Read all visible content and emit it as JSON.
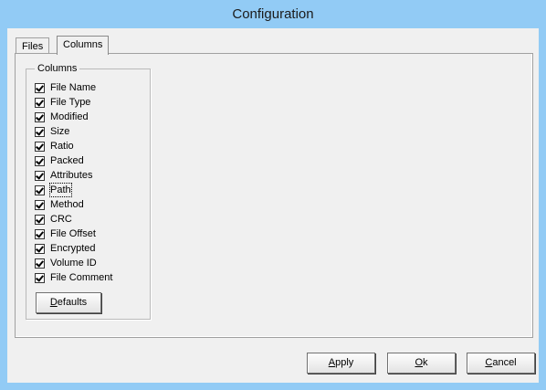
{
  "window": {
    "title": "Configuration"
  },
  "tabs": [
    {
      "label": "Files",
      "active": false
    },
    {
      "label": "Columns",
      "active": true
    }
  ],
  "columns_group": {
    "legend": "Columns",
    "items": [
      {
        "label": "File Name",
        "checked": true
      },
      {
        "label": "File Type",
        "checked": true
      },
      {
        "label": "Modified",
        "checked": true
      },
      {
        "label": "Size",
        "checked": true
      },
      {
        "label": "Ratio",
        "checked": true
      },
      {
        "label": "Packed",
        "checked": true
      },
      {
        "label": "Attributes",
        "checked": true
      },
      {
        "label": "Path",
        "checked": true
      },
      {
        "label": "Method",
        "checked": true
      },
      {
        "label": "CRC",
        "checked": true
      },
      {
        "label": "File Offset",
        "checked": true
      },
      {
        "label": "Encrypted",
        "checked": true
      },
      {
        "label": "Volume ID",
        "checked": true
      },
      {
        "label": "File Comment",
        "checked": true
      }
    ],
    "defaults_button": {
      "mnemonic": "D",
      "rest": "efaults"
    }
  },
  "buttons": {
    "apply": {
      "mnemonic": "A",
      "rest": "pply"
    },
    "ok": {
      "mnemonic": "O",
      "rest": "k"
    },
    "cancel": {
      "mnemonic": "C",
      "rest": "ancel"
    }
  },
  "colors": {
    "titlebar": "#92cbf5",
    "client": "#f0f0f0"
  }
}
